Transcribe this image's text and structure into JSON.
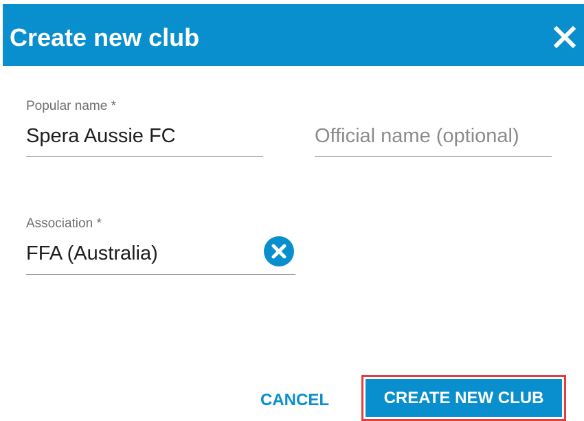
{
  "dialog": {
    "title": "Create new club",
    "header_color": "#0a8fce",
    "close_icon": "close-icon"
  },
  "form": {
    "popular_name": {
      "label": "Popular name *",
      "value": "Spera Aussie FC"
    },
    "official_name": {
      "placeholder": "Official name (optional)",
      "value": ""
    },
    "association": {
      "label": "Association *",
      "value": "FFA (Australia)",
      "clear_icon": "clear-circle-icon"
    }
  },
  "actions": {
    "cancel_label": "CANCEL",
    "create_label": "CREATE NEW CLUB",
    "highlight_color": "#e63c3c"
  }
}
